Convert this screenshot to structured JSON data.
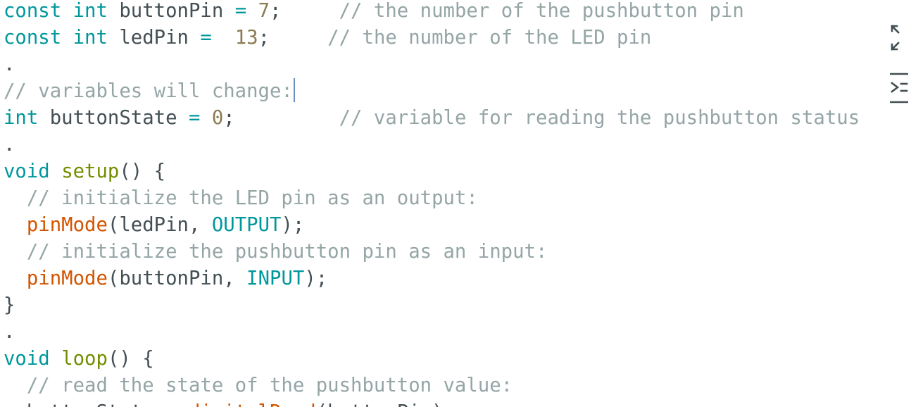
{
  "colors": {
    "keyword": "#00979c",
    "number": "#8a7b52",
    "comment": "#95a5a6",
    "function": "#d35400",
    "user_function": "#728e00",
    "plain": "#434f54"
  },
  "icons": {
    "collapse": "collapse-arrows-icon",
    "console": "console-toggle-icon"
  },
  "code": [
    [
      [
        "k",
        "const"
      ],
      [
        "p",
        " "
      ],
      [
        "k",
        "int"
      ],
      [
        "p",
        " buttonPin "
      ],
      [
        "k",
        "="
      ],
      [
        "p",
        " "
      ],
      [
        "n",
        "7"
      ],
      [
        "p",
        ";     "
      ],
      [
        "c",
        "// the number of the pushbutton pin"
      ]
    ],
    [
      [
        "k",
        "const"
      ],
      [
        "p",
        " "
      ],
      [
        "k",
        "int"
      ],
      [
        "p",
        " ledPin "
      ],
      [
        "k",
        "="
      ],
      [
        "p",
        "  "
      ],
      [
        "n",
        "13"
      ],
      [
        "p",
        ";     "
      ],
      [
        "c",
        "// the number of the LED pin"
      ]
    ],
    [
      [
        "p",
        "."
      ]
    ],
    [
      [
        "c",
        "// variables will change:"
      ],
      [
        "cursor",
        ""
      ]
    ],
    [
      [
        "k",
        "int"
      ],
      [
        "p",
        " buttonState "
      ],
      [
        "k",
        "="
      ],
      [
        "p",
        " "
      ],
      [
        "n",
        "0"
      ],
      [
        "p",
        ";         "
      ],
      [
        "c",
        "// variable for reading the pushbutton status"
      ]
    ],
    [
      [
        "p",
        "."
      ]
    ],
    [
      [
        "k",
        "void"
      ],
      [
        "p",
        " "
      ],
      [
        "d",
        "setup"
      ],
      [
        "p",
        "() {"
      ]
    ],
    [
      [
        "p",
        "  "
      ],
      [
        "c",
        "// initialize the LED pin as an output:"
      ]
    ],
    [
      [
        "p",
        "  "
      ],
      [
        "f",
        "pinMode"
      ],
      [
        "p",
        "(ledPin, "
      ],
      [
        "k",
        "OUTPUT"
      ],
      [
        "p",
        ");"
      ]
    ],
    [
      [
        "p",
        "  "
      ],
      [
        "c",
        "// initialize the pushbutton pin as an input:"
      ]
    ],
    [
      [
        "p",
        "  "
      ],
      [
        "f",
        "pinMode"
      ],
      [
        "p",
        "(buttonPin, "
      ],
      [
        "k",
        "INPUT"
      ],
      [
        "p",
        ");"
      ]
    ],
    [
      [
        "p",
        "}"
      ]
    ],
    [
      [
        "p",
        "."
      ]
    ],
    [
      [
        "k",
        "void"
      ],
      [
        "p",
        " "
      ],
      [
        "d",
        "loop"
      ],
      [
        "p",
        "() {"
      ]
    ],
    [
      [
        "p",
        "  "
      ],
      [
        "c",
        "// read the state of the pushbutton value:"
      ]
    ],
    [
      [
        "p",
        "  buttonState "
      ],
      [
        "k",
        "="
      ],
      [
        "p",
        " "
      ],
      [
        "f",
        "digitalRead"
      ],
      [
        "p",
        "(buttonPin);"
      ]
    ]
  ]
}
